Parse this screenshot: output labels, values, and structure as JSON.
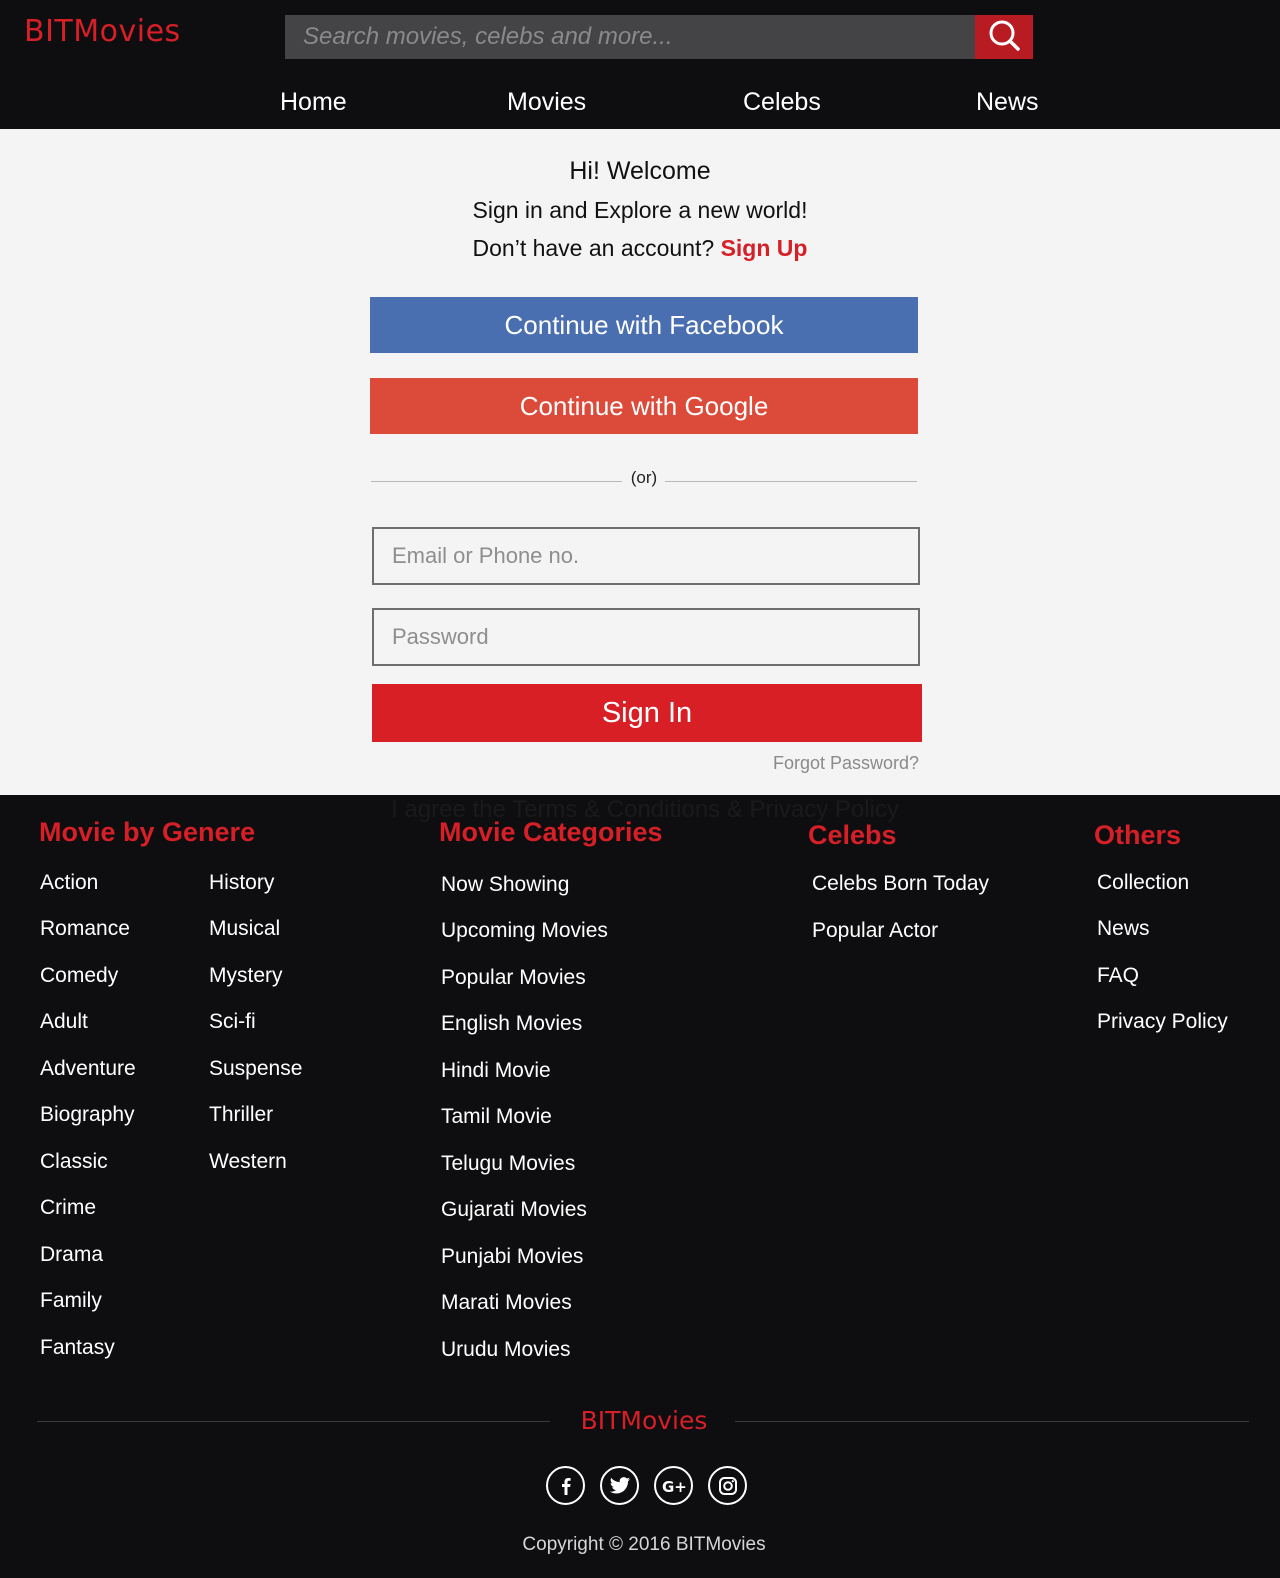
{
  "brand": "BITMovies",
  "search": {
    "placeholder": "Search movies, celebs and more...",
    "icon": "search-icon"
  },
  "nav": {
    "items": [
      "Home",
      "Movies",
      "Celebs",
      "News"
    ]
  },
  "login": {
    "title": "Hi! Welcome",
    "subtitle": "Sign in and Explore a new world!",
    "no_account": "Don’t have an account?",
    "signup_label": "Sign Up",
    "facebook_label": "Continue with Facebook",
    "google_label": "Continue with Google",
    "or_label": "(or)",
    "email_placeholder": "Email or Phone no.",
    "password_placeholder": "Password",
    "signin_label": "Sign In",
    "forgot_label": "Forgot Password?",
    "terms": "I agree the Terms & Conditions & Privacy Policy"
  },
  "footer": {
    "genre": {
      "title": "Movie by Genere",
      "col1": [
        "Action",
        "Romance",
        "Comedy",
        "Adult",
        "Adventure",
        "Biography",
        "Classic",
        "Crime",
        "Drama",
        "Family",
        "Fantasy"
      ],
      "col2": [
        "History",
        "Musical",
        "Mystery",
        "Sci-fi",
        "Suspense",
        "Thriller",
        "Western"
      ]
    },
    "categories": {
      "title": "Movie Categories",
      "items": [
        "Now Showing",
        "Upcoming Movies",
        "Popular Movies",
        "English Movies",
        "Hindi Movie",
        "Tamil Movie",
        "Telugu Movies",
        "Gujarati Movies",
        "Punjabi Movies",
        "Marati Movies",
        "Urudu Movies"
      ]
    },
    "celebs": {
      "title": "Celebs",
      "items": [
        "Celebs Born Today",
        "Popular Actor"
      ]
    },
    "others": {
      "title": "Others",
      "items": [
        "Collection",
        "News",
        "FAQ",
        "Privacy Policy"
      ]
    },
    "brand": "BITMovies",
    "social_icons": [
      "facebook-icon",
      "twitter-icon",
      "google-plus-icon",
      "instagram-icon"
    ],
    "copyright": "Copyright © 2016 BITMovies"
  },
  "colors": {
    "brand_red": "#d61f26",
    "facebook": "#4a6fb0",
    "google": "#dc4a3a",
    "header_bg": "#0e0e10"
  }
}
